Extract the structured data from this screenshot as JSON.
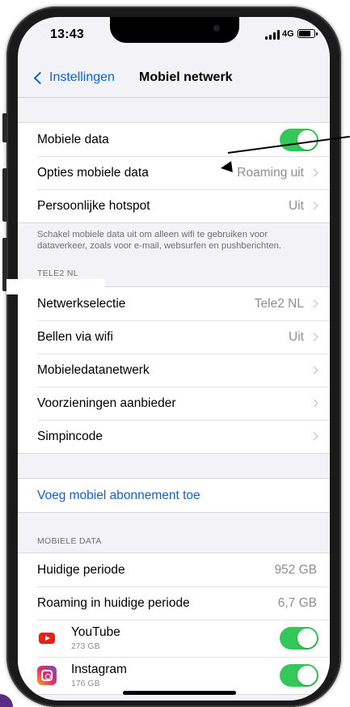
{
  "status_bar": {
    "time": "13:43",
    "network": "4G",
    "battery_level": 0.85
  },
  "nav": {
    "back_label": "Instellingen",
    "title": "Mobiel netwerk"
  },
  "group1": {
    "mobile_data_label": "Mobiele data",
    "mobile_data_on": true,
    "options_label": "Opties mobiele data",
    "options_value": "Roaming uit",
    "hotspot_label": "Persoonlijke hotspot",
    "hotspot_value": "Uit"
  },
  "footnote": "Schakel mobiele data uit om alleen wifi te gebruiken voor dataverkeer, zoals voor e-mail, websurfen en pushberichten.",
  "carrier_section": {
    "header": "TELE2 NL",
    "network_label": "Netwerkselectie",
    "network_value": "Tele2 NL",
    "wifi_calling_label": "Bellen via wifi",
    "wifi_calling_value": "Uit",
    "data_network_label": "Mobieledatanetwerk",
    "carrier_services_label": "Voorzieningen aanbieder",
    "sim_pin_label": "Simpincode"
  },
  "add_plan": {
    "label": "Voeg mobiel abonnement toe"
  },
  "mobile_data_section": {
    "header": "MOBIELE DATA",
    "current_period_label": "Huidige periode",
    "current_period_value": "952 GB",
    "roaming_period_label": "Roaming in huidige periode",
    "roaming_period_value": "6,7 GB",
    "apps": [
      {
        "name": "YouTube",
        "size": "273 GB",
        "enabled": true,
        "icon": "youtube-icon"
      },
      {
        "name": "Instagram",
        "size": "176 GB",
        "enabled": true,
        "icon": "instagram-icon"
      }
    ]
  },
  "colors": {
    "accent": "#0a63d6",
    "toggle_on": "#34c759",
    "background": "#f2f2f7"
  }
}
